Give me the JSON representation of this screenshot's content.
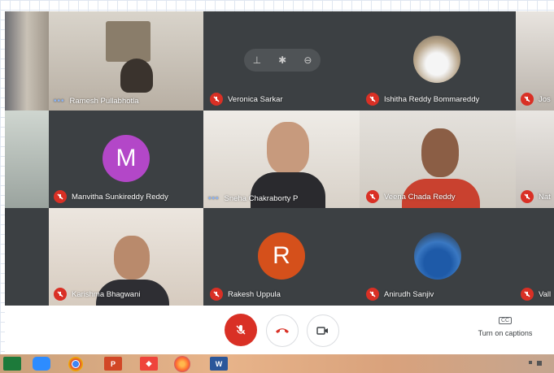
{
  "participants": [
    {
      "name": "Ramesh Pullabhotla",
      "status": "speaking"
    },
    {
      "name": "Veronica Sarkar",
      "status": "muted"
    },
    {
      "name": "Ishitha Reddy Bommareddy",
      "status": "muted"
    },
    {
      "name": "Jos",
      "status": "muted"
    },
    {
      "name": "Manvitha Sunkireddy Reddy",
      "status": "muted",
      "initial": "M",
      "color": "#b347c8"
    },
    {
      "name": "Sneha Chakraborty P",
      "status": "speaking"
    },
    {
      "name": "Veena Chada Reddy",
      "status": "muted"
    },
    {
      "name": "Nat",
      "status": "muted"
    },
    {
      "name": "Karishma Bhagwani",
      "status": "muted"
    },
    {
      "name": "Rakesh Uppula",
      "status": "muted",
      "initial": "R",
      "color": "#d5501b"
    },
    {
      "name": "Anirudh Sanjiv",
      "status": "muted"
    },
    {
      "name": "Vall",
      "status": "muted"
    }
  ],
  "controls": {
    "captions_label": "Turn on captions",
    "cc_icon_text": "CC",
    "mic_color": "#d93025",
    "hangup_color": "#d93025"
  },
  "taskbar": {
    "items": [
      "file-explorer",
      "zoom",
      "chrome",
      "powerpoint",
      "anydesk",
      "firefox",
      "word"
    ],
    "ppt_text": "P",
    "word_text": "W"
  },
  "colors": {
    "muted_badge": "#d93025",
    "meet_bg": "#202124"
  }
}
